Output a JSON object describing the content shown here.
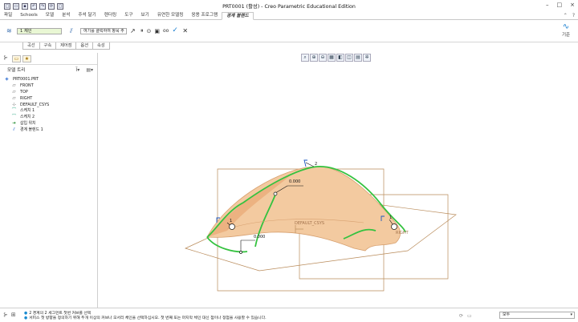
{
  "window": {
    "title": "PRT0001 (활성) - Creo Parametric Educational Edition",
    "controls": [
      "–",
      "□",
      "×"
    ]
  },
  "quick_access": [
    "new-icon",
    "open-icon",
    "save-icon",
    "undo-icon",
    "redo-icon",
    "regenerate-icon",
    "close-window-icon"
  ],
  "tabs": [
    "파일",
    "Schools",
    "모델",
    "분석",
    "주석 달기",
    "렌더링",
    "도구",
    "보기",
    "유연한 모델링",
    "응용 프로그램",
    "경계 블렌드"
  ],
  "active_tab": "경계 블렌드",
  "dashboard": {
    "chain_value": "1 체인",
    "chain_placeholder": "여기를 클릭하여 항목 추",
    "style_label": "기준",
    "buttons": [
      "pause-icon",
      "preview-icon",
      "verify-icon",
      "ok-icon",
      "cancel-icon"
    ],
    "pause_glyph": "⏸",
    "cancel_glyph": "✕",
    "ok_glyph": "✓"
  },
  "subtabs": [
    "곡선",
    "구속",
    "제어점",
    "옵션",
    "속성"
  ],
  "model_tree": {
    "header": "모델 트리",
    "items": [
      {
        "label": "PRT0001.PRT",
        "icon": "part-icon",
        "level": 0
      },
      {
        "label": "FRONT",
        "icon": "datum-plane-icon",
        "level": 1
      },
      {
        "label": "TOP",
        "icon": "datum-plane-icon",
        "level": 1
      },
      {
        "label": "RIGHT",
        "icon": "datum-plane-icon",
        "level": 1
      },
      {
        "label": "DEFAULT_CSYS",
        "icon": "csys-icon",
        "level": 1
      },
      {
        "label": "스케치 1",
        "icon": "sketch-icon",
        "level": 1
      },
      {
        "label": "스케치 2",
        "icon": "sketch-icon",
        "level": 1
      },
      {
        "label": "삽입 위치",
        "icon": "insert-arrow-icon",
        "level": 1
      },
      {
        "label": "경계 블렌드 1",
        "icon": "boundary-blend-icon",
        "level": 1
      }
    ]
  },
  "graphics": {
    "labels": {
      "front": "FRONT",
      "default_csys": "DEFAULT_CSYS",
      "right": "RIGHT",
      "val1": "0.000",
      "val2": "0.000",
      "num1": "1",
      "num2": "2",
      "num3": "1"
    },
    "colors": {
      "surface": "#f3caa0",
      "surface_edge": "#d7a06f",
      "curve": "#34c23f",
      "datum": "#b98b5a",
      "accent": "#1a7fd0"
    }
  },
  "status": {
    "line1": "2 경계의 2 세그먼트 첫번 커브를 선택",
    "line2": "서피스 첫 방향을 정의하기 위해 두개 이상의 커브나 모서리 체인을 선택하십시오. 첫 번째 또는 마지막 체인 대신 점이나 정점을 사용할 수 있습니다.",
    "filter": "모두"
  }
}
